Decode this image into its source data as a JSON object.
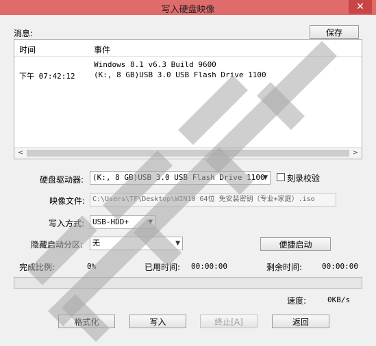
{
  "window": {
    "title": "写入硬盘映像",
    "close_label": "✕"
  },
  "messages": {
    "label": "消息:",
    "save_label": "保存",
    "columns": [
      "时间",
      "事件"
    ],
    "rows": [
      {
        "time": "",
        "event": "Windows 8.1 v6.3 Build 9600"
      },
      {
        "time": "下午 07:42:12",
        "event": "(K:, 8 GB)USB 3.0 USB Flash Drive 1100"
      }
    ]
  },
  "form": {
    "drive_label": "硬盘驱动器:",
    "drive_value": "(K:, 8 GB)USB 3.0 USB Flash Drive 1100",
    "verify_label": "刻录校验",
    "verify_checked": false,
    "image_label": "映像文件:",
    "image_value": "C:\\Users\\TF\\Desktop\\WIN10 64位 免安装密钥（专业+家庭）.iso",
    "write_mode_label": "写入方式:",
    "write_mode_value": "USB-HDD+",
    "hidden_partition_label": "隐藏启动分区:",
    "hidden_partition_value": "无",
    "quick_boot_label": "便捷启动"
  },
  "status": {
    "percent_label": "完成比例:",
    "percent_value": "0%",
    "elapsed_label": "已用时间:",
    "elapsed_value": "00:00:00",
    "remaining_label": "剩余时间:",
    "remaining_value": "00:00:00",
    "progress": 0,
    "speed_label": "速度:",
    "speed_value": "0KB/s"
  },
  "buttons": {
    "format": "格式化",
    "write": "写入",
    "stop": "终止[A]",
    "back": "返回"
  },
  "colors": {
    "titlebar": "#e06b6b",
    "progress_fill": "#06b025"
  }
}
